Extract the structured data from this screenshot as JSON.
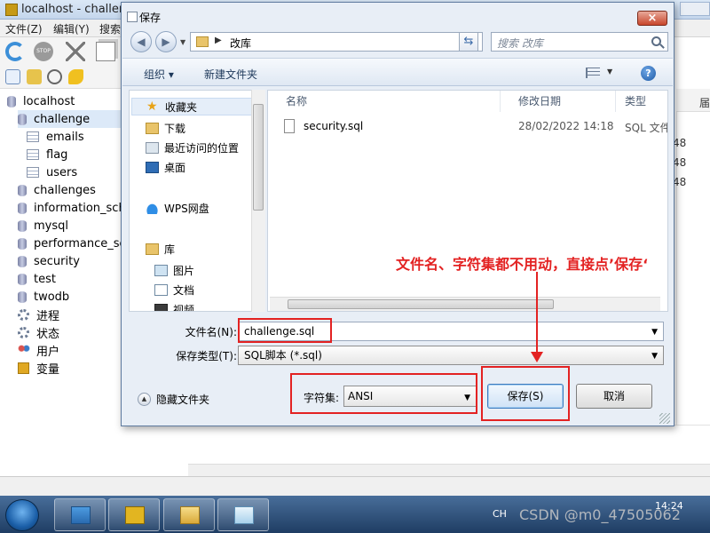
{
  "app": {
    "title": "localhost - challen",
    "menu": [
      "文件(Z)",
      "编辑(Y)",
      "搜索"
    ],
    "tree": [
      {
        "label": "localhost",
        "kind": "db"
      },
      {
        "label": "challenge",
        "kind": "db"
      },
      {
        "label": "emails",
        "kind": "table"
      },
      {
        "label": "flag",
        "kind": "table"
      },
      {
        "label": "users",
        "kind": "table"
      },
      {
        "label": "challenges",
        "kind": "db"
      },
      {
        "label": "information_sche",
        "kind": "db"
      },
      {
        "label": "mysql",
        "kind": "db"
      },
      {
        "label": "performance_sch",
        "kind": "db"
      },
      {
        "label": "security",
        "kind": "db"
      },
      {
        "label": "test",
        "kind": "db"
      },
      {
        "label": "twodb",
        "kind": "db"
      },
      {
        "label": "进程",
        "kind": "gear"
      },
      {
        "label": "状态",
        "kind": "gear"
      },
      {
        "label": "用户",
        "kind": "users"
      },
      {
        "label": "变量",
        "kind": "var"
      }
    ],
    "right_header": "届",
    "right_cells": [
      "48",
      "48",
      "48"
    ]
  },
  "dialog": {
    "title": "保存",
    "close": "×",
    "address": "改库",
    "search_placeholder": "搜索 改库",
    "organize": "组织 ▾",
    "new_folder": "新建文件夹",
    "help": "?",
    "nav": {
      "favorites": "收藏夹",
      "downloads": "下载",
      "recent": "最近访问的位置",
      "desktop": "桌面",
      "wps": "WPS网盘",
      "library": "库",
      "pictures": "图片",
      "documents": "文档",
      "videos": "视频"
    },
    "columns": {
      "name": "名称",
      "date": "修改日期",
      "type": "类型"
    },
    "files": [
      {
        "name": "security.sql",
        "date": "28/02/2022 14:18",
        "type": "SQL 文件"
      }
    ],
    "filename_label": "文件名(N):",
    "filename_value": "challenge.sql",
    "filetype_label": "保存类型(T):",
    "filetype_value": "SQL脚本 (*.sql)",
    "hide_folders": "隐藏文件夹",
    "charset_label": "字符集:",
    "charset_value": "ANSI",
    "save_button": "保存(S)",
    "cancel_button": "取消"
  },
  "annotation": {
    "text": "文件名、字符集都不用动，直接点’保存‘",
    "color": "#e32222"
  },
  "taskbar": {
    "lang": "CH",
    "clock": "14:24",
    "watermark": "CSDN @m0_47505062"
  }
}
